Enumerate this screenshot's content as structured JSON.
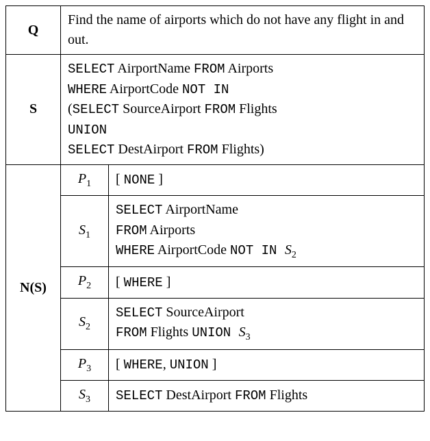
{
  "labels": {
    "Q": "Q",
    "S": "S",
    "NS": "N(S)"
  },
  "sublabels": {
    "P1": "P",
    "P1_sub": "1",
    "S1": "S",
    "S1_sub": "1",
    "P2": "P",
    "P2_sub": "2",
    "S2": "S",
    "S2_sub": "2",
    "P3": "P",
    "P3_sub": "3",
    "S3": "S",
    "S3_sub": "3"
  },
  "Q_text": "Find the name of airports which do not have any flight in and out.",
  "S_parts": {
    "l1_a": "SELECT",
    "l1_b": " AirportName ",
    "l1_c": "FROM",
    "l1_d": " Airports",
    "l2_a": "WHERE",
    "l2_b": " AirportCode ",
    "l2_c": "NOT IN",
    "l3_a": "(",
    "l3_b": "SELECT",
    "l3_c": " SourceAirport ",
    "l3_d": "FROM",
    "l3_e": " Flights",
    "l4_a": "UNION",
    "l5_a": "SELECT",
    "l5_b": " DestAirport ",
    "l5_c": "FROM",
    "l5_d": " Flights)"
  },
  "P1": {
    "a": "[ ",
    "b": "NONE",
    "c": " ]"
  },
  "S1": {
    "l1_a": "SELECT",
    "l1_b": " AirportName",
    "l2_a": "FROM",
    "l2_b": " Airports",
    "l3_a": "WHERE",
    "l3_b": " AirportCode ",
    "l3_c": "NOT IN ",
    "l3_d": "S",
    "l3_e": "2"
  },
  "P2": {
    "a": "[ ",
    "b": "WHERE",
    "c": " ]"
  },
  "S2": {
    "l1_a": "SELECT",
    "l1_b": " SourceAirport",
    "l2_a": "FROM",
    "l2_b": " Flights ",
    "l2_c": "UNION ",
    "l2_d": "S",
    "l2_e": "3"
  },
  "P3": {
    "a": "[ ",
    "b": "WHERE",
    "c": ", ",
    "d": "UNION",
    "e": " ]"
  },
  "S3": {
    "a": "SELECT",
    "b": " DestAirport ",
    "c": "FROM",
    "d": " Flights"
  }
}
